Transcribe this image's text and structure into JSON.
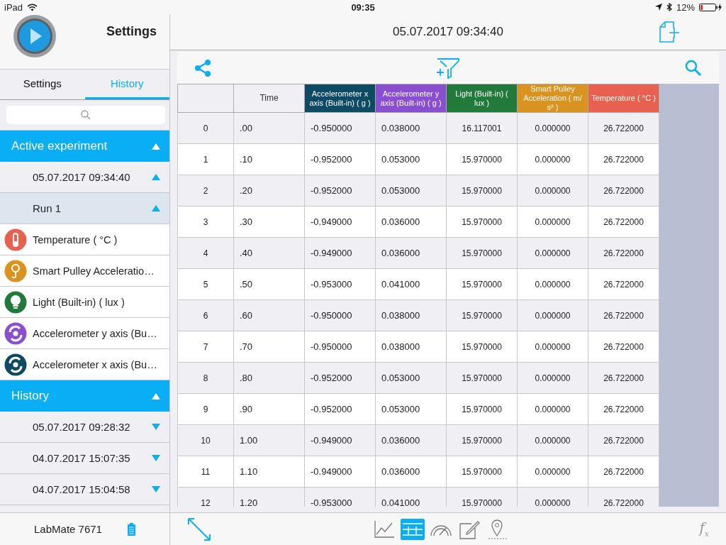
{
  "status_bar": {
    "device": "iPad",
    "time": "09:35",
    "battery": "12%"
  },
  "sidebar": {
    "title": "Settings",
    "tabs": [
      {
        "label": "Settings",
        "selected": false
      },
      {
        "label": "History",
        "selected": true
      }
    ],
    "tree": [
      {
        "label": "Active experiment",
        "expanded": true,
        "children": [
          {
            "label": "05.07.2017 09:34:40",
            "expanded": true,
            "children": [
              {
                "label": "Run 1",
                "expanded": true,
                "children": [
                  {
                    "label": "Temperature ( °C )",
                    "kind": "thermometer",
                    "color": "#e8604f"
                  },
                  {
                    "label": "Smart Pulley Acceleratio…",
                    "kind": "pulley",
                    "color": "#d9931e"
                  },
                  {
                    "label": "Light (Built-in) ( lux )",
                    "kind": "bulb",
                    "color": "#217a3a"
                  },
                  {
                    "label": "Accelerometer y axis (Bu…",
                    "kind": "rotation",
                    "color": "#8a4fd0"
                  },
                  {
                    "label": "Accelerometer x axis (Bu…",
                    "kind": "rotation",
                    "color": "#0e4a63"
                  }
                ]
              }
            ]
          }
        ]
      },
      {
        "label": "History",
        "expanded": true,
        "children": [
          {
            "label": "05.07.2017 09:28:32",
            "expanded": false
          },
          {
            "label": "04.07.2017 15:07:35",
            "expanded": false
          },
          {
            "label": "04.07.2017 15:04:58",
            "expanded": false
          }
        ]
      }
    ],
    "device": "LabMate 7671"
  },
  "header": {
    "title": "05.07.2017 09:34:40"
  },
  "table": {
    "columns": [
      {
        "label": "Time"
      },
      {
        "label": "Accelerometer x axis (Built-in) ( g )",
        "color": "#0e4a63"
      },
      {
        "label": "Accelerometer y axis (Built-in) ( g )",
        "color": "#8a4fd0"
      },
      {
        "label": "Light (Built-in) ( lux )",
        "color": "#217a3a"
      },
      {
        "label": "Smart Pulley Acceleration ( m/ s² )",
        "color": "#d9931e"
      },
      {
        "label": "Temperature ( °C )",
        "color": "#e8604f"
      }
    ],
    "rows": [
      {
        "index": "0",
        "cells": [
          ".00",
          "-0.950000",
          "0.038000",
          "16.117001",
          "0.000000",
          "26.722000"
        ]
      },
      {
        "index": "1",
        "cells": [
          ".10",
          "-0.952000",
          "0.053000",
          "15.970000",
          "0.000000",
          "26.722000"
        ]
      },
      {
        "index": "2",
        "cells": [
          ".20",
          "-0.952000",
          "0.053000",
          "15.970000",
          "0.000000",
          "26.722000"
        ]
      },
      {
        "index": "3",
        "cells": [
          ".30",
          "-0.949000",
          "0.036000",
          "15.970000",
          "0.000000",
          "26.722000"
        ]
      },
      {
        "index": "4",
        "cells": [
          ".40",
          "-0.949000",
          "0.036000",
          "15.970000",
          "0.000000",
          "26.722000"
        ]
      },
      {
        "index": "5",
        "cells": [
          ".50",
          "-0.953000",
          "0.041000",
          "15.970000",
          "0.000000",
          "26.722000"
        ]
      },
      {
        "index": "6",
        "cells": [
          ".60",
          "-0.950000",
          "0.038000",
          "15.970000",
          "0.000000",
          "26.722000"
        ]
      },
      {
        "index": "7",
        "cells": [
          ".70",
          "-0.950000",
          "0.038000",
          "15.970000",
          "0.000000",
          "26.722000"
        ]
      },
      {
        "index": "8",
        "cells": [
          ".80",
          "-0.952000",
          "0.053000",
          "15.970000",
          "0.000000",
          "26.722000"
        ]
      },
      {
        "index": "9",
        "cells": [
          ".90",
          "-0.952000",
          "0.053000",
          "15.970000",
          "0.000000",
          "26.722000"
        ]
      },
      {
        "index": "10",
        "cells": [
          "1.00",
          "-0.949000",
          "0.036000",
          "15.970000",
          "0.000000",
          "26.722000"
        ]
      },
      {
        "index": "11",
        "cells": [
          "1.10",
          "-0.949000",
          "0.036000",
          "15.970000",
          "0.000000",
          "26.722000"
        ]
      },
      {
        "index": "12",
        "cells": [
          "1.20",
          "-0.953000",
          "0.041000",
          "15.970000",
          "0.000000",
          "26.722000"
        ]
      }
    ]
  },
  "bottom_bar": {
    "views": [
      {
        "kind": "graph",
        "selected": false
      },
      {
        "kind": "table",
        "selected": true
      },
      {
        "kind": "meter",
        "selected": false
      },
      {
        "kind": "notes",
        "selected": false
      },
      {
        "kind": "map",
        "selected": false
      }
    ],
    "function_button": {
      "label": "f",
      "subscript": "x"
    }
  }
}
